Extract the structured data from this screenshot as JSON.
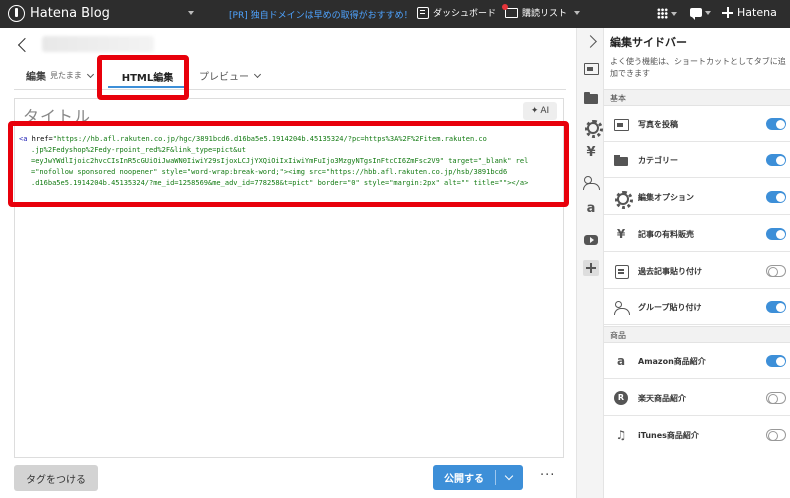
{
  "topbar": {
    "brand": "Hatena Blog",
    "promo": "[PR] 独自ドメインは早めの取得がおすすめ！",
    "dashboard": "ダッシュボード",
    "reading_list": "購読リスト",
    "hatena": "Hatena"
  },
  "editor": {
    "tabs": {
      "edit": "編集",
      "edit_mode": "見たまま",
      "html": "HTML編集",
      "preview": "プレビュー"
    },
    "title_placeholder": "タイトル",
    "ai_label": "AI",
    "code_lines": [
      {
        "a": "<a",
        "b": " href=",
        "c": "\"https://hb.afl.rakuten.co.jp/hgc/3891bcd6.d16ba5e5.1914204b.45135324/?pc=https%3A%2F%2Fitem.rakuten.co"
      },
      {
        "a": "",
        "b": "",
        "c": ".jp%2Fedyshop%2Fedy-rpoint_red%2F&link_type=pict&ut"
      },
      {
        "a": "",
        "b": "",
        "c": "=eyJwYWdlIjoic2hvcCIsInR5cGUiOiJwaWN0IiwiY29sIjoxLCJjYXQiOiIxIiwiYmFuIjo3MzgyNTgsInFtcCI6ZmFsc2V9\" target=\"_blank\" rel"
      },
      {
        "a": "",
        "b": "",
        "c": "=\"nofollow sponsored noopener\" style=\"word-wrap:break-word;\"><img src=\"https://hbb.afl.rakuten.co.jp/hsb/3891bcd6"
      },
      {
        "a": "",
        "b": "",
        "c": ".d16ba5e5.1914204b.45135324/?me_id=1258569&me_adv_id=778258&t=pict\" border=\"0\" style=\"margin:2px\" alt=\"\" title=\"\"></a>"
      }
    ],
    "tag_button": "タグをつける",
    "publish_button": "公開する",
    "more": "···"
  },
  "sidebar": {
    "title": "編集サイドバー",
    "description": "よく使う機能は、ショートカットとしてタブに追加できます",
    "sections": {
      "basic": "基本",
      "products": "商品"
    },
    "items": [
      {
        "label": "写真を投稿",
        "icon": "photo-icon",
        "on": true
      },
      {
        "label": "カテゴリー",
        "icon": "folder-icon",
        "on": true
      },
      {
        "label": "編集オプション",
        "icon": "gear-icon",
        "on": true
      },
      {
        "label": "記事の有料販売",
        "icon": "yen-icon",
        "on": true
      },
      {
        "label": "過去記事貼り付け",
        "icon": "paste-icon",
        "on": false
      },
      {
        "label": "グループ貼り付け",
        "icon": "group-icon",
        "on": true
      },
      {
        "label": "Amazon商品紹介",
        "icon": "amazon-icon",
        "on": true
      },
      {
        "label": "楽天商品紹介",
        "icon": "rakuten-icon",
        "on": false
      },
      {
        "label": "iTunes商品紹介",
        "icon": "music-icon",
        "on": false
      }
    ],
    "glyphs": {
      "yen": "¥",
      "amazon": "a",
      "rakuten": "R",
      "music": "♫"
    }
  },
  "colors": {
    "accent": "#3d8fd8",
    "topbar": "#2d2d2d",
    "highlight": "#e8000b"
  }
}
